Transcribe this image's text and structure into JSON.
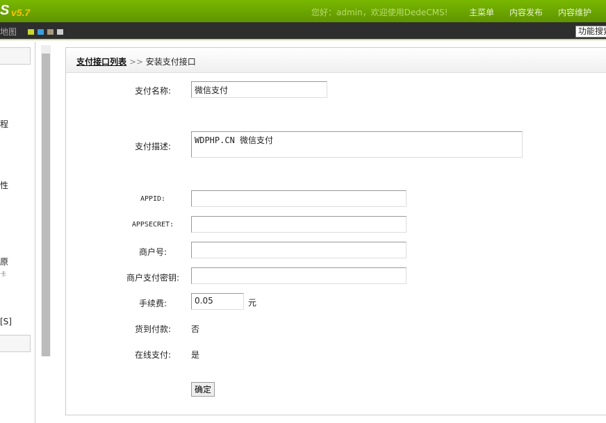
{
  "header": {
    "logo": "S",
    "version": "v5.7",
    "welcome": "您好：admin，欢迎使用DedeCMS!",
    "menu": [
      "主菜单",
      "内容发布",
      "内容维护"
    ]
  },
  "toolbar": {
    "site_map": "地图",
    "function_search": "功能搜索"
  },
  "sidebar": {
    "fragments": [
      "程",
      "性",
      "原",
      "卡",
      "[S]"
    ]
  },
  "breadcrumb": {
    "parent": "支付接口列表",
    "sep": ">>",
    "current": "安装支付接口"
  },
  "form": {
    "name_label": "支付名称:",
    "name_value": "微信支付",
    "desc_label": "支付描述:",
    "desc_value": "WDPHP.CN 微信支付",
    "appid_label": "APPID:",
    "appid_value": "",
    "appsecret_label": "APPSECRET:",
    "appsecret_value": "",
    "mch_label": "商户号:",
    "mch_value": "",
    "key_label": "商户支付密钥:",
    "key_value": "",
    "fee_label": "手续费:",
    "fee_value": "0.05",
    "fee_unit": "元",
    "cod_label": "货到付款:",
    "cod_value": "否",
    "online_label": "在线支付:",
    "online_value": "是",
    "submit": "确定"
  }
}
